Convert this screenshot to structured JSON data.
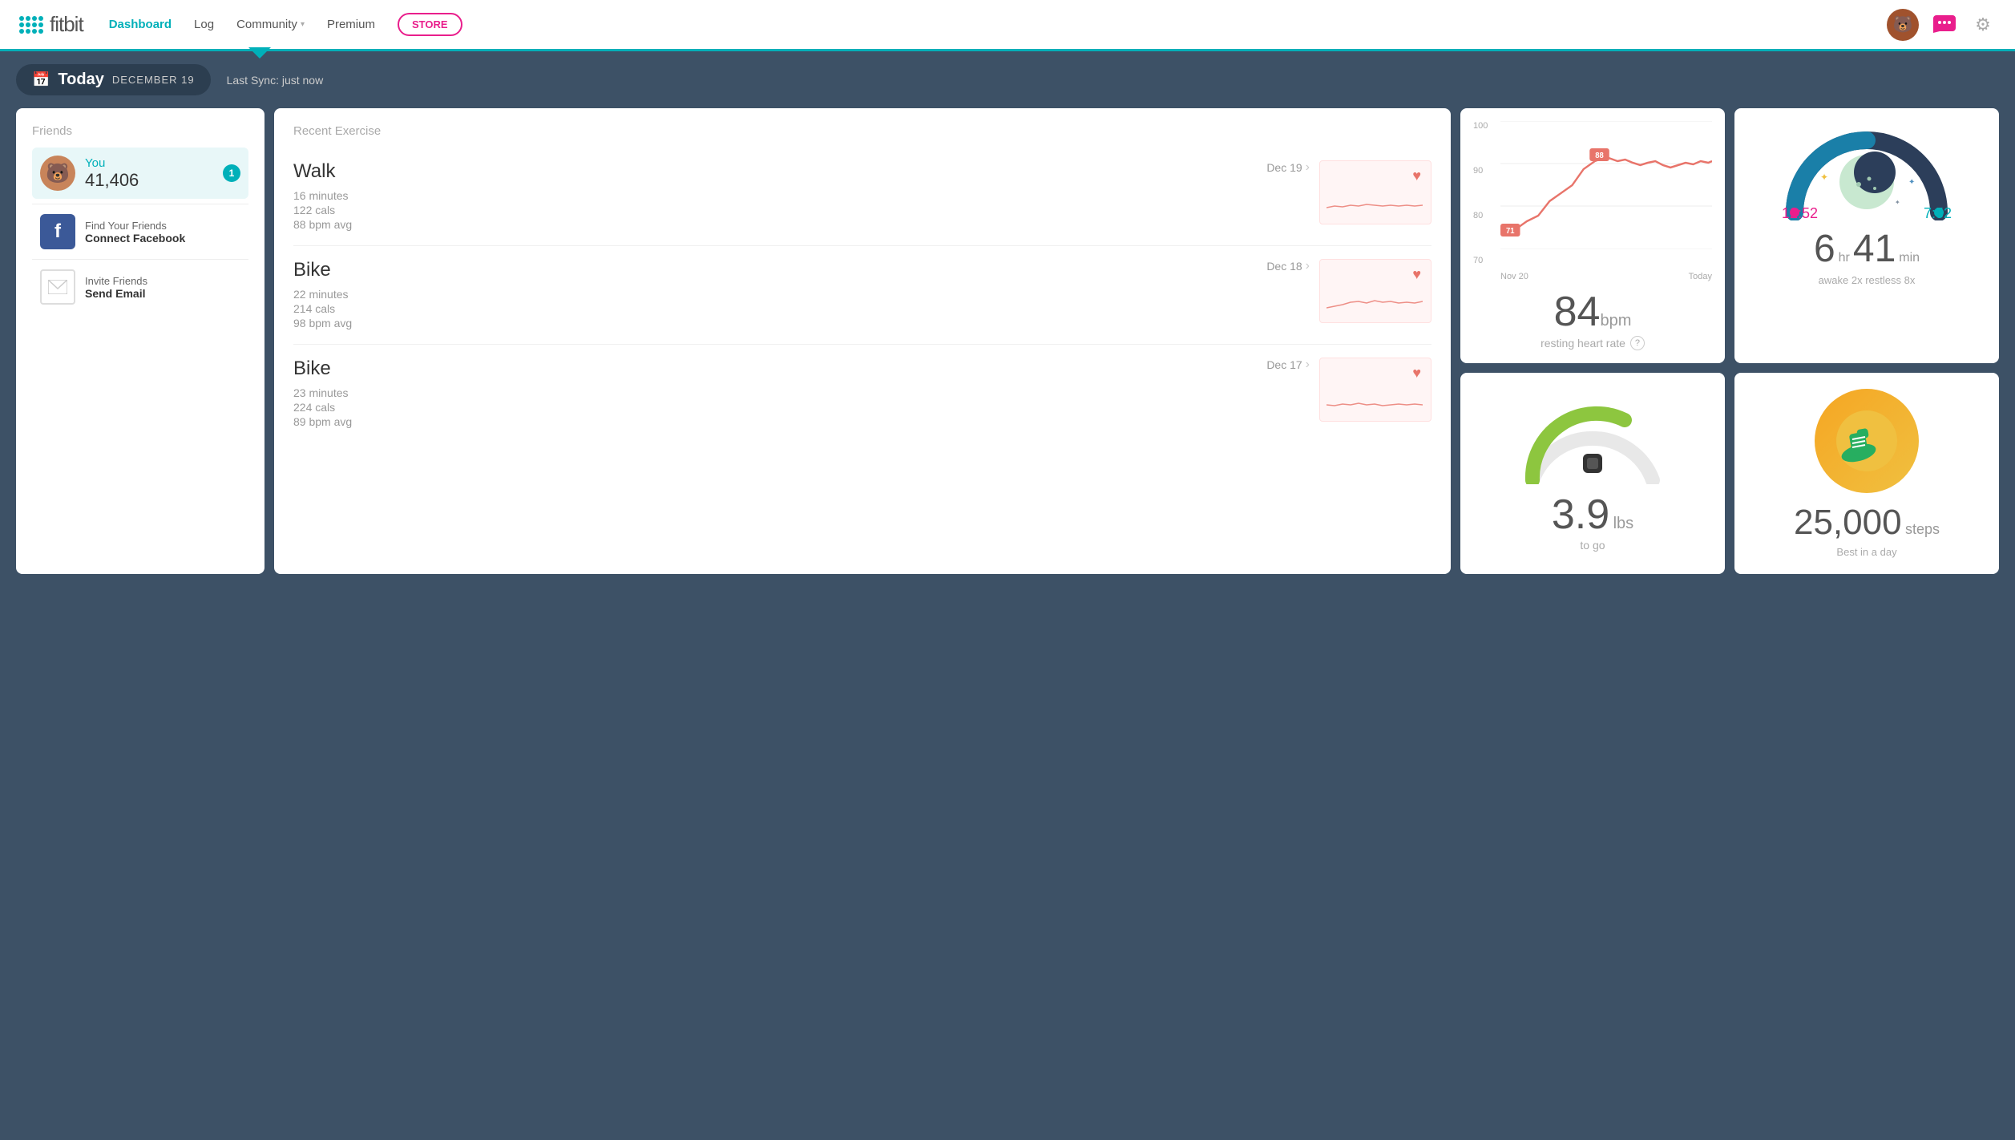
{
  "nav": {
    "logo_text": "fitbit",
    "links": [
      {
        "label": "Dashboard",
        "active": true
      },
      {
        "label": "Log",
        "active": false
      },
      {
        "label": "Community",
        "active": false,
        "has_arrow": true
      },
      {
        "label": "Premium",
        "active": false
      }
    ],
    "store_label": "STORE",
    "chat_icon": "chat-icon",
    "gear_icon": "gear-icon",
    "avatar_emoji": "🐻"
  },
  "date_bar": {
    "calendar_icon": "📅",
    "today_label": "Today",
    "date_label": "DECEMBER 19",
    "last_sync": "Last Sync: just now"
  },
  "friends": {
    "title": "Friends",
    "you": {
      "name": "You",
      "steps": "41,406",
      "badge": "1",
      "avatar_emoji": "🐻"
    },
    "facebook": {
      "line1": "Find Your Friends",
      "line2": "Connect Facebook"
    },
    "email": {
      "line1": "Invite Friends",
      "line2": "Send Email"
    }
  },
  "recent_exercise": {
    "title": "Recent Exercise",
    "items": [
      {
        "name": "Walk",
        "date": "Dec 19",
        "minutes": "16",
        "calories": "122",
        "bpm": "88",
        "minutes_label": "minutes",
        "cals_label": "cals",
        "bpm_label": "bpm avg"
      },
      {
        "name": "Bike",
        "date": "Dec 18",
        "minutes": "22",
        "calories": "214",
        "bpm": "98",
        "minutes_label": "minutes",
        "cals_label": "cals",
        "bpm_label": "bpm avg"
      },
      {
        "name": "Bike",
        "date": "Dec 17",
        "minutes": "23",
        "calories": "224",
        "bpm": "89",
        "minutes_label": "minutes",
        "cals_label": "cals",
        "bpm_label": "bpm avg"
      }
    ]
  },
  "heart_rate": {
    "y_labels": [
      "100",
      "90",
      "80",
      "70"
    ],
    "x_labels": [
      "Nov 20",
      "Today"
    ],
    "value": "84",
    "unit": "bpm",
    "label": "resting heart rate",
    "min_badge": "71",
    "max_badge": "88"
  },
  "sleep": {
    "time_start": "12:52",
    "time_end": "7:52",
    "hours": "6",
    "minutes": "41",
    "hours_unit": "hr",
    "minutes_unit": "min",
    "subtitle": "awake 2x   restless 8x"
  },
  "weight": {
    "value": "3.9",
    "unit": "lbs",
    "label": "to go"
  },
  "steps": {
    "value": "25,000",
    "unit": "steps",
    "label": "Best in a day",
    "icon": "👟"
  }
}
